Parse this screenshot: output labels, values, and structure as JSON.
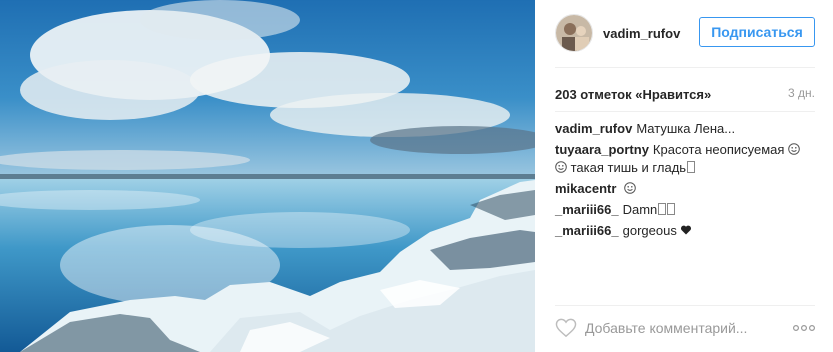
{
  "post": {
    "image_alt": "",
    "header": {
      "username": "vadim_rufov",
      "follow_label": "Подписаться"
    },
    "likes_text": "203 отметок «Нравится»",
    "time_ago": "3 дн.",
    "comments": [
      {
        "user": "vadim_rufov",
        "text": "Матушка Лена..."
      },
      {
        "user": "tuyaara_portny",
        "text": "Красота неописуемая",
        "text2": "такая тишь и гладь"
      },
      {
        "user": "mikacentr",
        "text": ""
      },
      {
        "user": "_mariii66_",
        "text": "Damn"
      },
      {
        "user": "_mariii66_",
        "text": "gorgeous"
      }
    ],
    "add_comment_placeholder": "Добавьте комментарий...",
    "colors": {
      "accent": "#3897f0",
      "text": "#262626",
      "muted": "#999999",
      "divider": "#efefef"
    },
    "icons": [
      "emoji-smile-icon",
      "heart-icon",
      "black-heart-icon",
      "more-options-icon"
    ]
  }
}
